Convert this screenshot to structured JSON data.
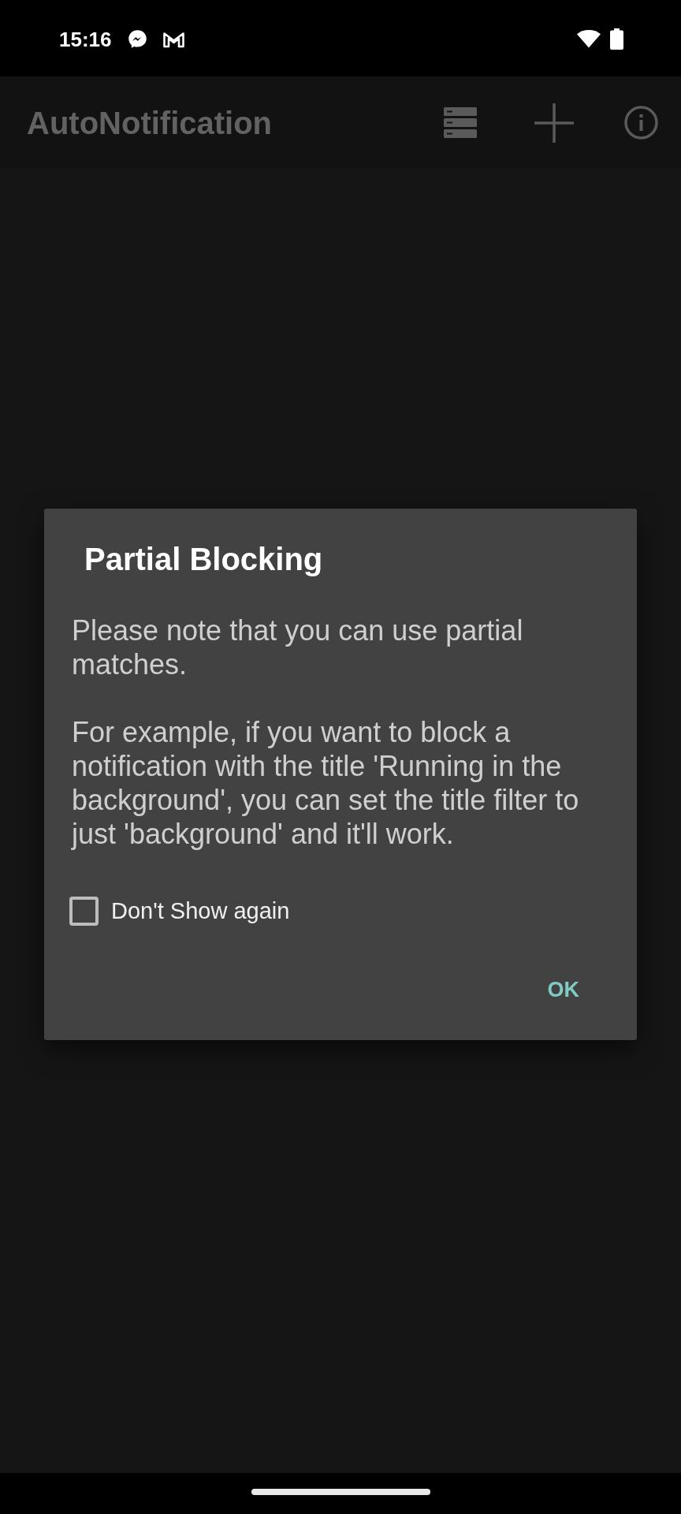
{
  "status_bar": {
    "time": "15:16"
  },
  "app_bar": {
    "title": "AutoNotification"
  },
  "dialog": {
    "title": "Partial Blocking",
    "message": [
      "Please note that you can use partial matches.",
      "For example, if you want to block a notification with the title 'Running in the background', you can set the title filter to just 'background' and it'll work."
    ],
    "checkbox": {
      "label": "Don't Show again",
      "checked": false
    },
    "buttons": [
      "OK"
    ]
  }
}
